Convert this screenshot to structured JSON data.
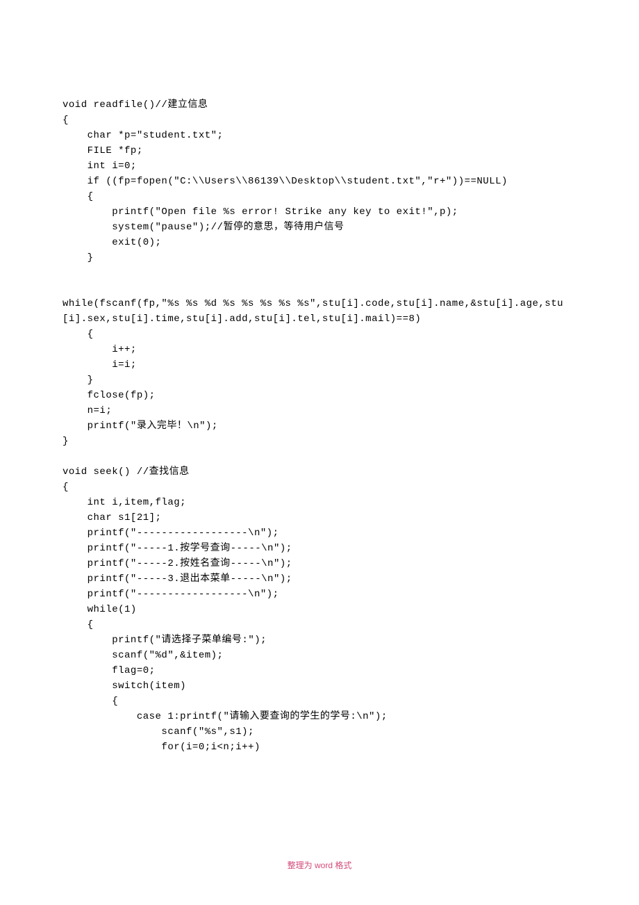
{
  "code": {
    "lines": [
      "void readfile()//建立信息",
      "{",
      "    char *p=\"student.txt\";",
      "    FILE *fp;",
      "    int i=0;",
      "    if ((fp=fopen(\"C:\\\\Users\\\\86139\\\\Desktop\\\\student.txt\",\"r+\"))==NULL)",
      "    {",
      "        printf(\"Open file %s error! Strike any key to exit!\",p);",
      "        system(\"pause\");//暂停的意思，等待用户信号",
      "        exit(0);",
      "    }",
      "",
      "",
      "while(fscanf(fp,\"%s %s %d %s %s %s %s %s\",stu[i].code,stu[i].name,&stu[i].age,stu[i].sex,stu[i].time,stu[i].add,stu[i].tel,stu[i].mail)==8)",
      "    {",
      "        i++;",
      "        i=i;",
      "    }",
      "    fclose(fp);",
      "    n=i;",
      "    printf(\"录入完毕！\\n\");",
      "}",
      "",
      "void seek() //查找信息",
      "{",
      "    int i,item,flag;",
      "    char s1[21];",
      "    printf(\"------------------\\n\");",
      "    printf(\"-----1.按学号查询-----\\n\");",
      "    printf(\"-----2.按姓名查询-----\\n\");",
      "    printf(\"-----3.退出本菜单-----\\n\");",
      "    printf(\"------------------\\n\");",
      "    while(1)",
      "    {",
      "        printf(\"请选择子菜单编号:\");",
      "        scanf(\"%d\",&item);",
      "        flag=0;",
      "        switch(item)",
      "        {",
      "            case 1:printf(\"请输入要查询的学生的学号:\\n\");",
      "                scanf(\"%s\",s1);",
      "                for(i=0;i<n;i++)"
    ]
  },
  "footer": {
    "text": "整理为 word 格式"
  }
}
